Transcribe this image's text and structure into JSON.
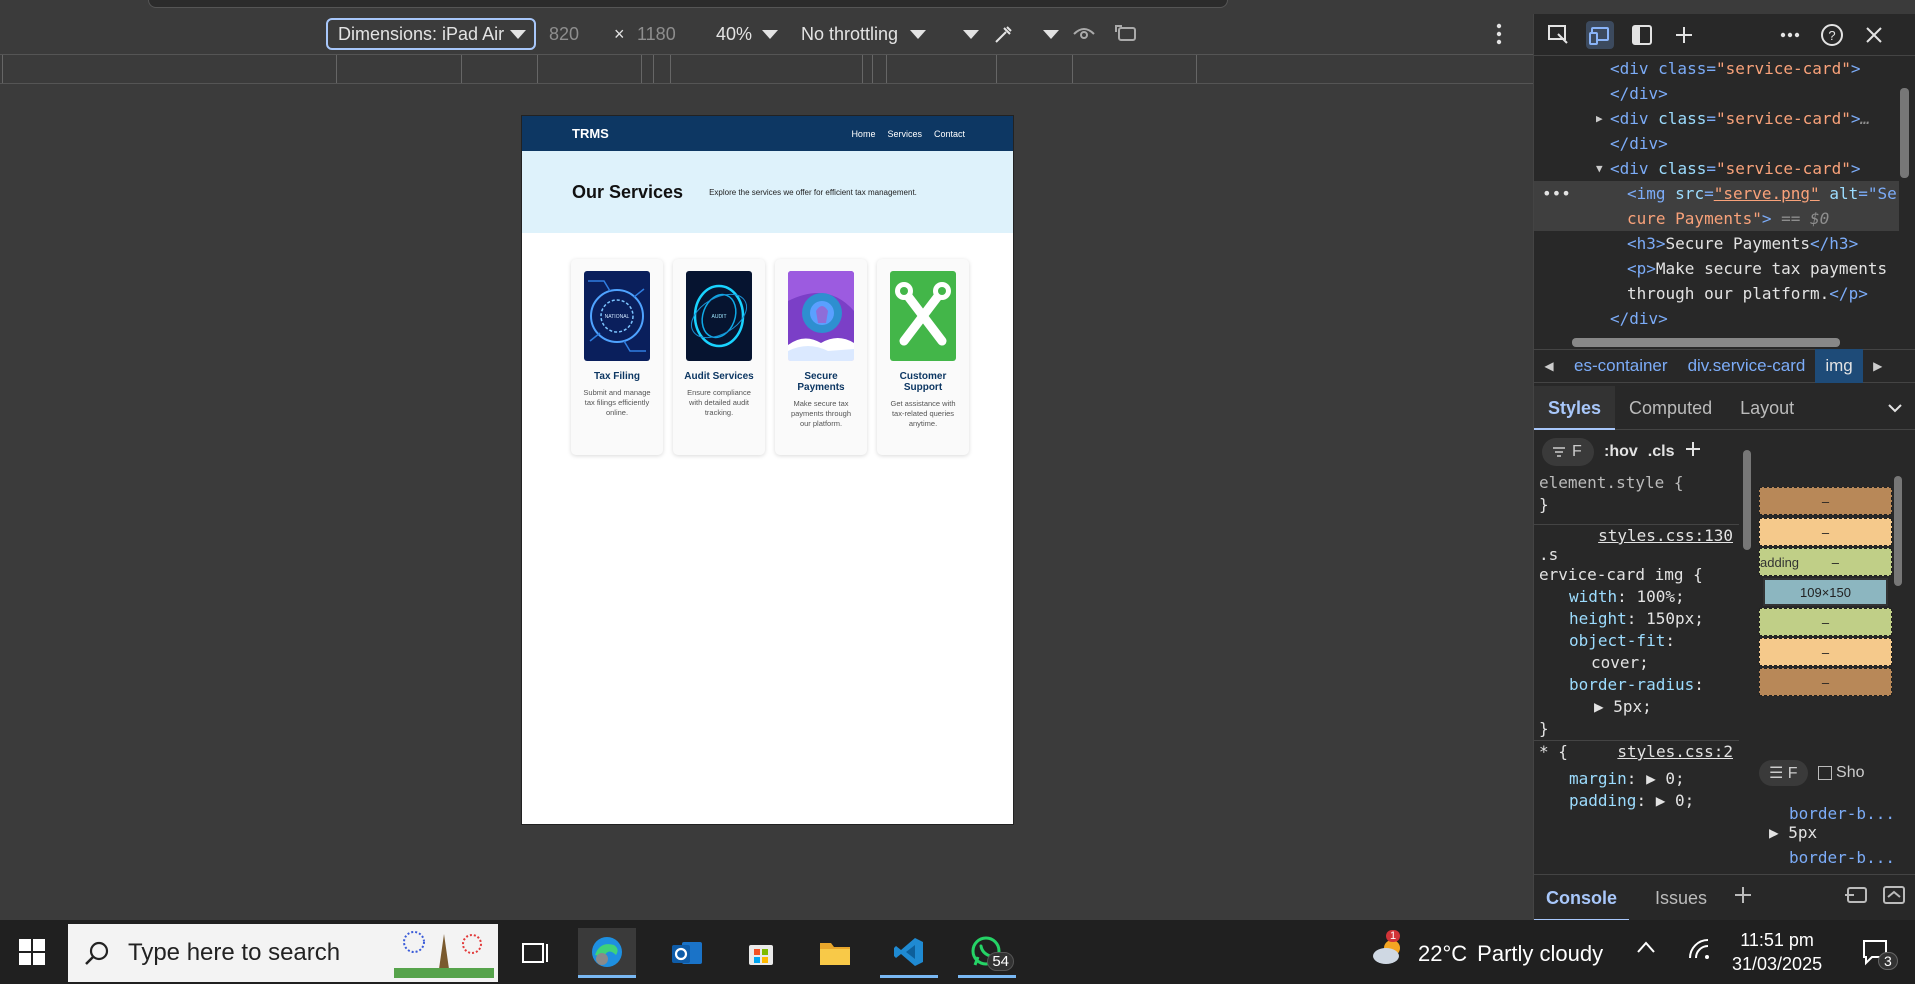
{
  "device_toolbar": {
    "dimensions_label": "Dimensions: iPad Air",
    "width": "820",
    "times": "×",
    "height": "1180",
    "zoom": "40%",
    "throttling": "No throttling"
  },
  "site": {
    "logo": "TRMS",
    "nav": [
      "Home",
      "Services",
      "Contact"
    ],
    "hero_title": "Our Services",
    "hero_subtitle": "Explore the services we offer for efficient tax management.",
    "cards": [
      {
        "title": "Tax Filing",
        "text": "Submit and manage tax filings efficiently online.",
        "image": "circuit-blue-image"
      },
      {
        "title": "Audit Services",
        "text": "Ensure compliance with detailed audit tracking.",
        "image": "circuit-swirl-image"
      },
      {
        "title": "Secure Payments",
        "text": "Make secure tax payments through our platform.",
        "image": "purple-abstract-image"
      },
      {
        "title": "Customer Support",
        "text": "Get assistance with tax-related queries anytime.",
        "image": "green-tools-image"
      }
    ]
  },
  "devtools": {
    "elements_lines": [
      {
        "indent": 1,
        "parts": [
          [
            "tag",
            "<div class="
          ],
          [
            "val",
            "\"service-card\""
          ],
          [
            "tag",
            ">"
          ]
        ]
      },
      {
        "indent": 1,
        "parts": [
          [
            "tag",
            "</div>"
          ]
        ]
      },
      {
        "indent": 0,
        "arrow": "right",
        "parts": [
          [
            "tag",
            "<div "
          ],
          [
            "attr",
            "class"
          ],
          [
            "tag",
            "="
          ],
          [
            "val",
            "\"service-card\""
          ],
          [
            "tag",
            ">"
          ],
          [
            "eq",
            "…"
          ]
        ]
      },
      {
        "indent": 1,
        "parts": [
          [
            "tag",
            "</div>"
          ]
        ]
      },
      {
        "indent": 0,
        "arrow": "down",
        "parts": [
          [
            "tag",
            "<div "
          ],
          [
            "attr",
            "class"
          ],
          [
            "tag",
            "="
          ],
          [
            "val",
            "\"service-card\""
          ],
          [
            "tag",
            ">"
          ]
        ]
      },
      {
        "indent": 2,
        "selected": true,
        "parts": [
          [
            "tag",
            "<img "
          ],
          [
            "attr",
            "src"
          ],
          [
            "tag",
            "="
          ],
          [
            "val",
            "\"serve.png\""
          ],
          [
            "tag",
            " "
          ],
          [
            "attr",
            "alt"
          ],
          [
            "tag",
            "=\"Se"
          ]
        ]
      },
      {
        "indent": 2,
        "selected": true,
        "parts": [
          [
            "val",
            "cure Payments\""
          ],
          [
            "tag",
            "> "
          ],
          [
            "eq",
            "== $0"
          ]
        ]
      },
      {
        "indent": 2,
        "parts": [
          [
            "tag",
            "<h3>"
          ],
          [
            "text",
            "Secure Payments"
          ],
          [
            "tag",
            "</h3>"
          ]
        ]
      },
      {
        "indent": 2,
        "parts": [
          [
            "tag",
            "<p>"
          ],
          [
            "text",
            "Make secure tax payments"
          ]
        ]
      },
      {
        "indent": 2,
        "parts": [
          [
            "text",
            "through our platform."
          ],
          [
            "tag",
            "</p>"
          ]
        ]
      },
      {
        "indent": 1,
        "parts": [
          [
            "tag",
            "</div>"
          ]
        ]
      }
    ],
    "breadcrumbs": [
      "es-container",
      "div.service-card",
      "img"
    ],
    "tabs": [
      "Styles",
      "Computed",
      "Layout"
    ],
    "filter_placeholder": "F",
    "hov": ":hov",
    "cls": ".cls",
    "element_style": "element.style {",
    "close_brace": "}",
    "rule1_source": "styles.css:130",
    "rule1_selector_a": ".s",
    "rule1_selector_b": "ervice-card img {",
    "rule1_props": [
      {
        "name": "width",
        "value": "100%;"
      },
      {
        "name": "height",
        "value": "150px;"
      },
      {
        "name": "object-fit",
        "value": ":"
      },
      {
        "name": "",
        "value": "cover;"
      },
      {
        "name": "border-radius",
        "value": ":"
      },
      {
        "name": "",
        "value": "5px;"
      }
    ],
    "rule2_selector": "* {",
    "rule2_source": "styles.css:2",
    "rule2_props": [
      {
        "name": "margin",
        "value": "0;"
      },
      {
        "name": "padding",
        "value": "0;"
      }
    ],
    "box_model": {
      "padding_label": "adding",
      "dash": "–",
      "content": "109×150"
    },
    "computed_filter": "F",
    "show_all": "Sho",
    "computed_props": [
      "border-b...",
      "5px",
      "border-b..."
    ],
    "drawer_tabs": [
      "Console",
      "Issues"
    ]
  },
  "taskbar": {
    "search_placeholder": "Type here to search",
    "whatsapp_badge": "54",
    "weather_badge": "1",
    "temperature": "22°C",
    "weather": "Partly cloudy",
    "time": "11:51 pm",
    "date": "31/03/2025",
    "notification_count": "3"
  }
}
